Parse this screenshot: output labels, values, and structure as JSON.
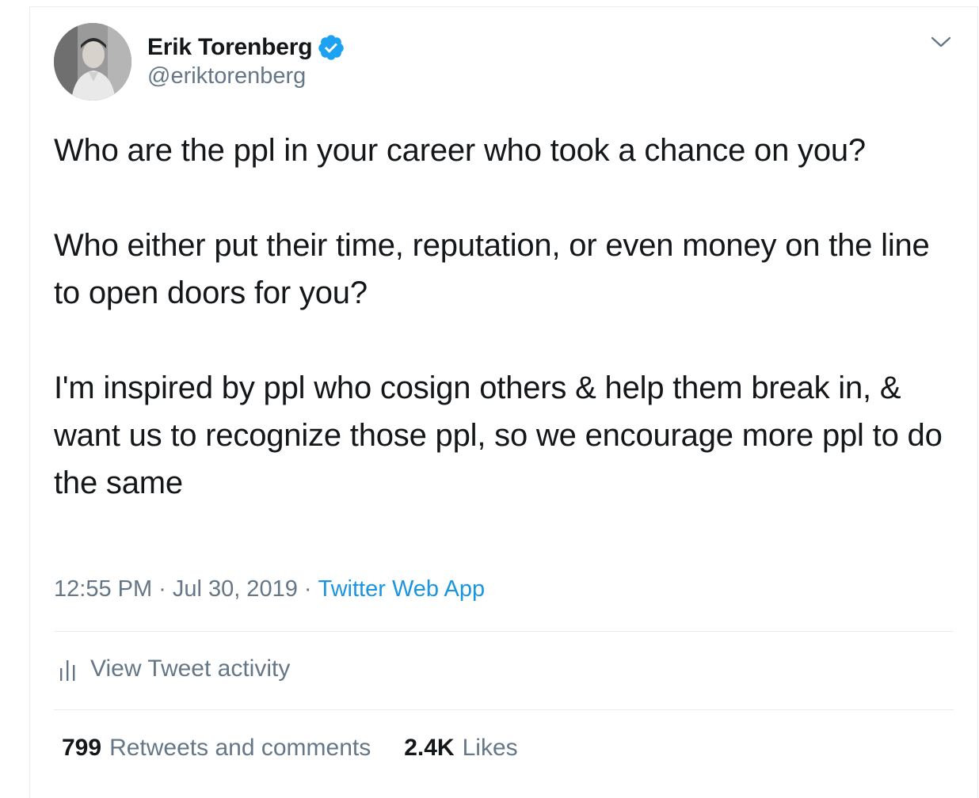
{
  "author": {
    "name": "Erik Torenberg",
    "handle": "@eriktorenberg",
    "verified": true
  },
  "tweet": {
    "paragraphs": [
      "Who are the ppl in your career who took a chance on you?",
      "Who either put their time, reputation, or even money on the line to open doors for you?",
      "I'm inspired by ppl who cosign others & help them break in, & want us to recognize those ppl, so we encourage more ppl to do the same"
    ],
    "time": "12:55 PM",
    "separator": "·",
    "date": "Jul 30, 2019",
    "source": "Twitter Web App"
  },
  "activity": {
    "label": "View Tweet activity"
  },
  "stats": {
    "retweets_count": "799",
    "retweets_label": "Retweets and comments",
    "likes_count": "2.4K",
    "likes_label": "Likes"
  },
  "icons": {
    "verified": "verified-badge-icon",
    "caret": "chevron-down-icon",
    "activity": "bar-chart-icon"
  },
  "colors": {
    "accent": "#1b95e0",
    "verified": "#1da1f2",
    "text": "#14171a",
    "muted": "#657786",
    "divider": "#e6ecf0"
  }
}
